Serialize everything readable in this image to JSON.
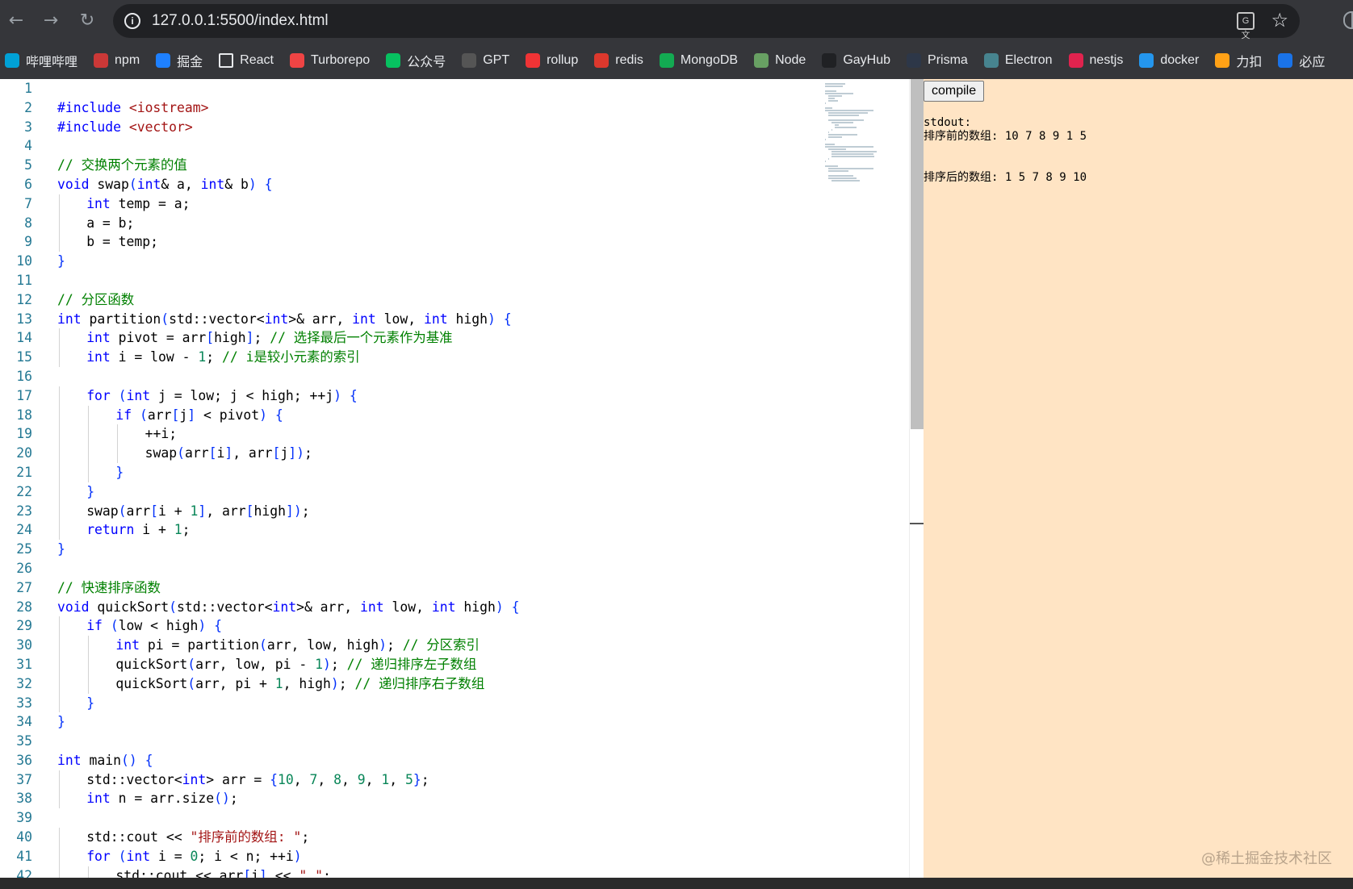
{
  "browser": {
    "back_icon": "arrow-left-icon",
    "forward_icon": "arrow-right-icon",
    "reload_icon": "reload-icon",
    "url": "127.0.0.1:5500/index.html",
    "bookmarks": [
      {
        "label": "哔哩哔哩",
        "icon": "bilibili-icon",
        "color": "#00a1d6"
      },
      {
        "label": "npm",
        "icon": "npm-icon",
        "color": "#cb3837"
      },
      {
        "label": "掘金",
        "icon": "juejin-icon",
        "color": "#1e80ff"
      },
      {
        "label": "React",
        "icon": "folder-icon",
        "color": "#35363a"
      },
      {
        "label": "Turborepo",
        "icon": "turborepo-icon",
        "color": "#ef4444"
      },
      {
        "label": "公众号",
        "icon": "wechat-icon",
        "color": "#07c160"
      },
      {
        "label": "GPT",
        "icon": "openai-icon",
        "color": "#555555"
      },
      {
        "label": "rollup",
        "icon": "rollup-icon",
        "color": "#ef3335"
      },
      {
        "label": "redis",
        "icon": "redis-icon",
        "color": "#dc382d"
      },
      {
        "label": "MongoDB",
        "icon": "mongodb-icon",
        "color": "#13aa52"
      },
      {
        "label": "Node",
        "icon": "node-icon",
        "color": "#68a063"
      },
      {
        "label": "GayHub",
        "icon": "github-icon",
        "color": "#202124"
      },
      {
        "label": "Prisma",
        "icon": "prisma-icon",
        "color": "#2d3748"
      },
      {
        "label": "Electron",
        "icon": "electron-icon",
        "color": "#47848f"
      },
      {
        "label": "nestjs",
        "icon": "nestjs-icon",
        "color": "#e0234e"
      },
      {
        "label": "docker",
        "icon": "docker-icon",
        "color": "#2496ed"
      },
      {
        "label": "力扣",
        "icon": "leetcode-icon",
        "color": "#ffa116"
      },
      {
        "label": "必应",
        "icon": "bing-search-icon",
        "color": "#1a73e8"
      }
    ]
  },
  "editor": {
    "lines": [
      {
        "n": "1",
        "indent": 0,
        "parts": []
      },
      {
        "n": "2",
        "indent": 0,
        "parts": [
          {
            "c": "k",
            "t": "#include"
          },
          {
            "c": "",
            "t": " "
          },
          {
            "c": "s",
            "t": "<iostream>"
          }
        ]
      },
      {
        "n": "3",
        "indent": 0,
        "parts": [
          {
            "c": "k",
            "t": "#include"
          },
          {
            "c": "",
            "t": " "
          },
          {
            "c": "s",
            "t": "<vector>"
          }
        ]
      },
      {
        "n": "4",
        "indent": 0,
        "parts": []
      },
      {
        "n": "5",
        "indent": 0,
        "parts": [
          {
            "c": "c",
            "t": "// 交换两个元素的值"
          }
        ]
      },
      {
        "n": "6",
        "indent": 0,
        "parts": [
          {
            "c": "k",
            "t": "void"
          },
          {
            "c": "",
            "t": " swap"
          },
          {
            "c": "b",
            "t": "("
          },
          {
            "c": "k",
            "t": "int"
          },
          {
            "c": "",
            "t": "& a, "
          },
          {
            "c": "k",
            "t": "int"
          },
          {
            "c": "",
            "t": "& b"
          },
          {
            "c": "b",
            "t": ")"
          },
          {
            "c": "",
            "t": " "
          },
          {
            "c": "b",
            "t": "{"
          }
        ]
      },
      {
        "n": "7",
        "indent": 1,
        "parts": [
          {
            "c": "k",
            "t": "int"
          },
          {
            "c": "",
            "t": " temp = a;"
          }
        ]
      },
      {
        "n": "8",
        "indent": 1,
        "parts": [
          {
            "c": "",
            "t": "a = b;"
          }
        ]
      },
      {
        "n": "9",
        "indent": 1,
        "parts": [
          {
            "c": "",
            "t": "b = temp;"
          }
        ]
      },
      {
        "n": "10",
        "indent": 0,
        "parts": [
          {
            "c": "b",
            "t": "}"
          }
        ]
      },
      {
        "n": "11",
        "indent": 0,
        "parts": []
      },
      {
        "n": "12",
        "indent": 0,
        "parts": [
          {
            "c": "c",
            "t": "// 分区函数"
          }
        ]
      },
      {
        "n": "13",
        "indent": 0,
        "parts": [
          {
            "c": "k",
            "t": "int"
          },
          {
            "c": "",
            "t": " partition"
          },
          {
            "c": "b",
            "t": "("
          },
          {
            "c": "",
            "t": "std::vector<"
          },
          {
            "c": "k",
            "t": "int"
          },
          {
            "c": "",
            "t": ">& arr, "
          },
          {
            "c": "k",
            "t": "int"
          },
          {
            "c": "",
            "t": " low, "
          },
          {
            "c": "k",
            "t": "int"
          },
          {
            "c": "",
            "t": " high"
          },
          {
            "c": "b",
            "t": ")"
          },
          {
            "c": "",
            "t": " "
          },
          {
            "c": "b",
            "t": "{"
          }
        ]
      },
      {
        "n": "14",
        "indent": 1,
        "parts": [
          {
            "c": "k",
            "t": "int"
          },
          {
            "c": "",
            "t": " pivot = arr"
          },
          {
            "c": "b",
            "t": "["
          },
          {
            "c": "",
            "t": "high"
          },
          {
            "c": "b",
            "t": "]"
          },
          {
            "c": "",
            "t": "; "
          },
          {
            "c": "c",
            "t": "// 选择最后一个元素作为基准"
          }
        ]
      },
      {
        "n": "15",
        "indent": 1,
        "parts": [
          {
            "c": "k",
            "t": "int"
          },
          {
            "c": "",
            "t": " i = low - "
          },
          {
            "c": "n",
            "t": "1"
          },
          {
            "c": "",
            "t": "; "
          },
          {
            "c": "c",
            "t": "// i是较小元素的索引"
          }
        ]
      },
      {
        "n": "16",
        "indent": 0,
        "parts": []
      },
      {
        "n": "17",
        "indent": 1,
        "parts": [
          {
            "c": "k",
            "t": "for"
          },
          {
            "c": "",
            "t": " "
          },
          {
            "c": "b",
            "t": "("
          },
          {
            "c": "k",
            "t": "int"
          },
          {
            "c": "",
            "t": " j = low; j < high; ++j"
          },
          {
            "c": "b",
            "t": ")"
          },
          {
            "c": "",
            "t": " "
          },
          {
            "c": "b",
            "t": "{"
          }
        ]
      },
      {
        "n": "18",
        "indent": 2,
        "parts": [
          {
            "c": "k",
            "t": "if"
          },
          {
            "c": "",
            "t": " "
          },
          {
            "c": "b",
            "t": "("
          },
          {
            "c": "",
            "t": "arr"
          },
          {
            "c": "b",
            "t": "["
          },
          {
            "c": "",
            "t": "j"
          },
          {
            "c": "b",
            "t": "]"
          },
          {
            "c": "",
            "t": " < pivot"
          },
          {
            "c": "b",
            "t": ")"
          },
          {
            "c": "",
            "t": " "
          },
          {
            "c": "b",
            "t": "{"
          }
        ]
      },
      {
        "n": "19",
        "indent": 3,
        "parts": [
          {
            "c": "",
            "t": "++i;"
          }
        ]
      },
      {
        "n": "20",
        "indent": 3,
        "parts": [
          {
            "c": "",
            "t": "swap"
          },
          {
            "c": "b",
            "t": "("
          },
          {
            "c": "",
            "t": "arr"
          },
          {
            "c": "b",
            "t": "["
          },
          {
            "c": "",
            "t": "i"
          },
          {
            "c": "b",
            "t": "]"
          },
          {
            "c": "",
            "t": ", arr"
          },
          {
            "c": "b",
            "t": "["
          },
          {
            "c": "",
            "t": "j"
          },
          {
            "c": "b",
            "t": "])"
          },
          {
            "c": "",
            "t": ";"
          }
        ]
      },
      {
        "n": "21",
        "indent": 2,
        "parts": [
          {
            "c": "b",
            "t": "}"
          }
        ]
      },
      {
        "n": "22",
        "indent": 1,
        "parts": [
          {
            "c": "b",
            "t": "}"
          }
        ]
      },
      {
        "n": "23",
        "indent": 1,
        "parts": [
          {
            "c": "",
            "t": "swap"
          },
          {
            "c": "b",
            "t": "("
          },
          {
            "c": "",
            "t": "arr"
          },
          {
            "c": "b",
            "t": "["
          },
          {
            "c": "",
            "t": "i + "
          },
          {
            "c": "n",
            "t": "1"
          },
          {
            "c": "b",
            "t": "]"
          },
          {
            "c": "",
            "t": ", arr"
          },
          {
            "c": "b",
            "t": "["
          },
          {
            "c": "",
            "t": "high"
          },
          {
            "c": "b",
            "t": "])"
          },
          {
            "c": "",
            "t": ";"
          }
        ]
      },
      {
        "n": "24",
        "indent": 1,
        "parts": [
          {
            "c": "k",
            "t": "return"
          },
          {
            "c": "",
            "t": " i + "
          },
          {
            "c": "n",
            "t": "1"
          },
          {
            "c": "",
            "t": ";"
          }
        ]
      },
      {
        "n": "25",
        "indent": 0,
        "parts": [
          {
            "c": "b",
            "t": "}"
          }
        ]
      },
      {
        "n": "26",
        "indent": 0,
        "parts": []
      },
      {
        "n": "27",
        "indent": 0,
        "parts": [
          {
            "c": "c",
            "t": "// 快速排序函数"
          }
        ]
      },
      {
        "n": "28",
        "indent": 0,
        "parts": [
          {
            "c": "k",
            "t": "void"
          },
          {
            "c": "",
            "t": " quickSort"
          },
          {
            "c": "b",
            "t": "("
          },
          {
            "c": "",
            "t": "std::vector<"
          },
          {
            "c": "k",
            "t": "int"
          },
          {
            "c": "",
            "t": ">& arr, "
          },
          {
            "c": "k",
            "t": "int"
          },
          {
            "c": "",
            "t": " low, "
          },
          {
            "c": "k",
            "t": "int"
          },
          {
            "c": "",
            "t": " high"
          },
          {
            "c": "b",
            "t": ")"
          },
          {
            "c": "",
            "t": " "
          },
          {
            "c": "b",
            "t": "{"
          }
        ]
      },
      {
        "n": "29",
        "indent": 1,
        "parts": [
          {
            "c": "k",
            "t": "if"
          },
          {
            "c": "",
            "t": " "
          },
          {
            "c": "b",
            "t": "("
          },
          {
            "c": "",
            "t": "low < high"
          },
          {
            "c": "b",
            "t": ")"
          },
          {
            "c": "",
            "t": " "
          },
          {
            "c": "b",
            "t": "{"
          }
        ]
      },
      {
        "n": "30",
        "indent": 2,
        "parts": [
          {
            "c": "k",
            "t": "int"
          },
          {
            "c": "",
            "t": " pi = partition"
          },
          {
            "c": "b",
            "t": "("
          },
          {
            "c": "",
            "t": "arr, low, high"
          },
          {
            "c": "b",
            "t": ")"
          },
          {
            "c": "",
            "t": "; "
          },
          {
            "c": "c",
            "t": "// 分区索引"
          }
        ]
      },
      {
        "n": "31",
        "indent": 2,
        "parts": [
          {
            "c": "",
            "t": "quickSort"
          },
          {
            "c": "b",
            "t": "("
          },
          {
            "c": "",
            "t": "arr, low, pi - "
          },
          {
            "c": "n",
            "t": "1"
          },
          {
            "c": "b",
            "t": ")"
          },
          {
            "c": "",
            "t": "; "
          },
          {
            "c": "c",
            "t": "// 递归排序左子数组"
          }
        ]
      },
      {
        "n": "32",
        "indent": 2,
        "parts": [
          {
            "c": "",
            "t": "quickSort"
          },
          {
            "c": "b",
            "t": "("
          },
          {
            "c": "",
            "t": "arr, pi + "
          },
          {
            "c": "n",
            "t": "1"
          },
          {
            "c": "",
            "t": ", high"
          },
          {
            "c": "b",
            "t": ")"
          },
          {
            "c": "",
            "t": "; "
          },
          {
            "c": "c",
            "t": "// 递归排序右子数组"
          }
        ]
      },
      {
        "n": "33",
        "indent": 1,
        "parts": [
          {
            "c": "b",
            "t": "}"
          }
        ]
      },
      {
        "n": "34",
        "indent": 0,
        "parts": [
          {
            "c": "b",
            "t": "}"
          }
        ]
      },
      {
        "n": "35",
        "indent": 0,
        "parts": []
      },
      {
        "n": "36",
        "indent": 0,
        "parts": [
          {
            "c": "k",
            "t": "int"
          },
          {
            "c": "",
            "t": " main"
          },
          {
            "c": "b",
            "t": "()"
          },
          {
            "c": "",
            "t": " "
          },
          {
            "c": "b",
            "t": "{"
          }
        ]
      },
      {
        "n": "37",
        "indent": 1,
        "parts": [
          {
            "c": "",
            "t": "std::vector<"
          },
          {
            "c": "k",
            "t": "int"
          },
          {
            "c": "",
            "t": "> arr = "
          },
          {
            "c": "b",
            "t": "{"
          },
          {
            "c": "n",
            "t": "10"
          },
          {
            "c": "",
            "t": ", "
          },
          {
            "c": "n",
            "t": "7"
          },
          {
            "c": "",
            "t": ", "
          },
          {
            "c": "n",
            "t": "8"
          },
          {
            "c": "",
            "t": ", "
          },
          {
            "c": "n",
            "t": "9"
          },
          {
            "c": "",
            "t": ", "
          },
          {
            "c": "n",
            "t": "1"
          },
          {
            "c": "",
            "t": ", "
          },
          {
            "c": "n",
            "t": "5"
          },
          {
            "c": "b",
            "t": "}"
          },
          {
            "c": "",
            "t": ";"
          }
        ]
      },
      {
        "n": "38",
        "indent": 1,
        "parts": [
          {
            "c": "k",
            "t": "int"
          },
          {
            "c": "",
            "t": " n = arr.size"
          },
          {
            "c": "b",
            "t": "()"
          },
          {
            "c": "",
            "t": ";"
          }
        ]
      },
      {
        "n": "39",
        "indent": 0,
        "parts": []
      },
      {
        "n": "40",
        "indent": 1,
        "parts": [
          {
            "c": "",
            "t": "std::cout << "
          },
          {
            "c": "s",
            "t": "\"排序前的数组: \""
          },
          {
            "c": "",
            "t": ";"
          }
        ]
      },
      {
        "n": "41",
        "indent": 1,
        "parts": [
          {
            "c": "k",
            "t": "for"
          },
          {
            "c": "",
            "t": " "
          },
          {
            "c": "b",
            "t": "("
          },
          {
            "c": "k",
            "t": "int"
          },
          {
            "c": "",
            "t": " i = "
          },
          {
            "c": "n",
            "t": "0"
          },
          {
            "c": "",
            "t": "; i < n; ++i"
          },
          {
            "c": "b",
            "t": ")"
          }
        ]
      },
      {
        "n": "42",
        "indent": 2,
        "parts": [
          {
            "c": "",
            "t": "std::cout << arr"
          },
          {
            "c": "b",
            "t": "["
          },
          {
            "c": "",
            "t": "i"
          },
          {
            "c": "b",
            "t": "]"
          },
          {
            "c": "",
            "t": " << "
          },
          {
            "c": "s",
            "t": "\" \""
          },
          {
            "c": "",
            "t": ";"
          }
        ]
      }
    ]
  },
  "panel": {
    "compile_label": "compile",
    "stdout_label": "stdout:",
    "stdout_lines": [
      "排序前的数组: 10 7 8 9 1 5",
      "",
      "",
      "排序后的数组: 1 5 7 8 9 10"
    ]
  },
  "watermark": "@稀土掘金技术社区"
}
